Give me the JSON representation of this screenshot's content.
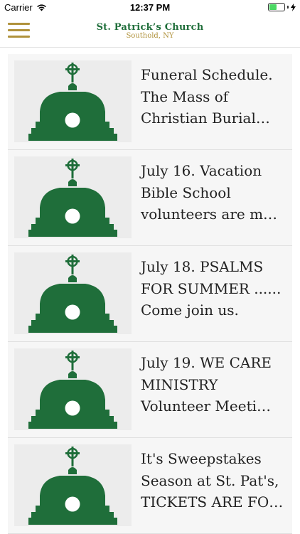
{
  "status_bar": {
    "carrier": "Carrier",
    "time": "12:37 PM"
  },
  "header": {
    "menu_icon": "hamburger-menu-icon",
    "logo_title": "St. Patrick’s Church",
    "logo_subtitle": "Southold, NY",
    "accent_color": "#b0923c",
    "brand_color": "#1f6e3a"
  },
  "news": [
    {
      "thumbnail_icon": "church-dome-icon",
      "title": "Funeral Schedule.\nThe Mass of\nChristian Burial…"
    },
    {
      "thumbnail_icon": "church-dome-icon",
      "title": "July 16. Vacation\nBible School\nvolunteers are m…"
    },
    {
      "thumbnail_icon": "church-dome-icon",
      "title": "July 18. PSALMS\nFOR SUMMER ......\nCome join us."
    },
    {
      "thumbnail_icon": "church-dome-icon",
      "title": "July 19. WE CARE\nMINISTRY\nVolunteer Meeti…"
    },
    {
      "thumbnail_icon": "church-dome-icon",
      "title": "It's Sweepstakes\nSeason at St. Pat's,\nTICKETS ARE FO…"
    }
  ]
}
